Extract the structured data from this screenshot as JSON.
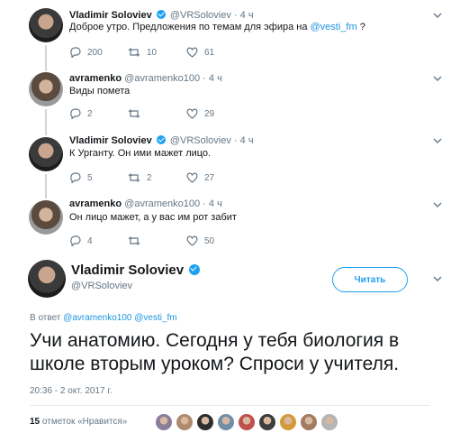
{
  "tweets": [
    {
      "name": "Vladimir Soloviev",
      "handle": "@VRSoloviev",
      "time": "4 ч",
      "text": "Доброе утро. Предложения по темам для эфира на ",
      "mention": "@vesti_fm",
      "text_after": " ?",
      "replies": "200",
      "retweets": "10",
      "likes": "61"
    },
    {
      "name": "avramenko",
      "handle": "@avramenko100",
      "time": "4 ч",
      "text": "Виды помета",
      "replies": "2",
      "retweets": "",
      "likes": "29"
    },
    {
      "name": "Vladimir Soloviev",
      "handle": "@VRSoloviev",
      "time": "4 ч",
      "text": "К Урганту. Он ими мажет лицо.",
      "replies": "5",
      "retweets": "2",
      "likes": "27"
    },
    {
      "name": "avramenko",
      "handle": "@avramenko100",
      "time": "4 ч",
      "text": "Он лицо мажет, а у вас им рот забит",
      "replies": "4",
      "retweets": "",
      "likes": "50"
    }
  ],
  "main": {
    "name": "Vladimir Soloviev",
    "handle": "@VRSoloviev",
    "follow_label": "Читать",
    "reply_prefix": "В ответ ",
    "reply_mentions": "@avramenko100 @vesti_fm",
    "text": "Учи анатомию. Сегодня у тебя биология в школе вторым уроком? Спроси у учителя.",
    "datetime": "20:36 - 2 окт. 2017 г.",
    "likes_count": "15",
    "likes_label": " отметок «Нравится»"
  },
  "colors": {
    "accent": "#1da1f2",
    "link": "#1b95e0",
    "muted": "#657786",
    "liker_avatars": [
      "#8a7d9a",
      "#b08a6e",
      "#2e2e2e",
      "#6f8fa8",
      "#c0504d",
      "#3d3d3d",
      "#d49a3a",
      "#a37b63",
      "#b5b5b5"
    ]
  }
}
